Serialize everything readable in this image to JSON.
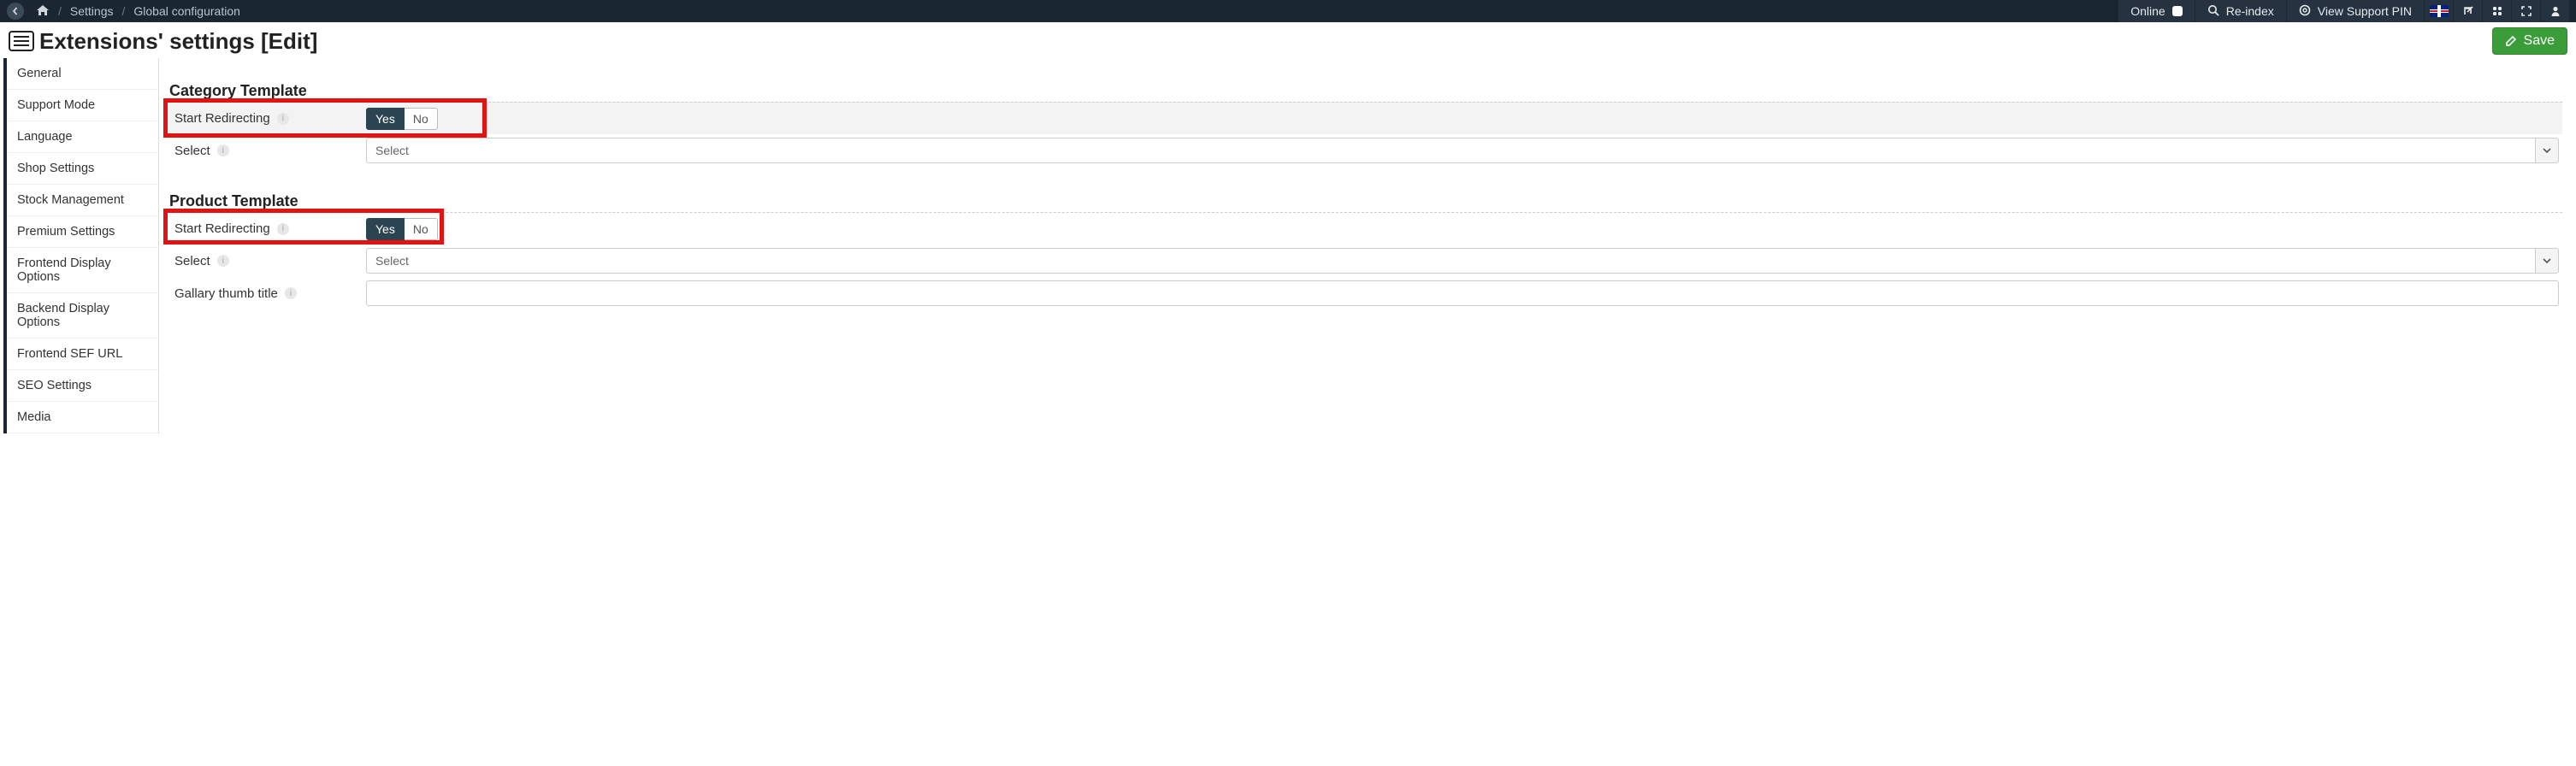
{
  "topbar": {
    "breadcrumb": {
      "settings": "Settings",
      "current": "Global configuration"
    },
    "online_label": "Online",
    "reindex_label": "Re-index",
    "view_pin_label": "View Support PIN"
  },
  "page": {
    "title": "Extensions' settings [Edit]",
    "save_label": "Save"
  },
  "sidebar": {
    "items": [
      "General",
      "Support Mode",
      "Language",
      "Shop Settings",
      "Stock Management",
      "Premium Settings",
      "Frontend Display Options",
      "Backend Display Options",
      "Frontend SEF URL",
      "SEO Settings",
      "Media"
    ]
  },
  "sections": {
    "category": {
      "title": "Category Template",
      "start_redirecting_label": "Start Redirecting",
      "start_redirecting_value": "Yes",
      "select_label": "Select",
      "select_value": "Select"
    },
    "product": {
      "title": "Product Template",
      "start_redirecting_label": "Start Redirecting",
      "start_redirecting_value": "Yes",
      "select_label": "Select",
      "select_value": "Select",
      "gallery_thumb_label": "Gallary thumb title",
      "gallery_thumb_value": ""
    }
  },
  "toggle": {
    "yes": "Yes",
    "no": "No"
  }
}
